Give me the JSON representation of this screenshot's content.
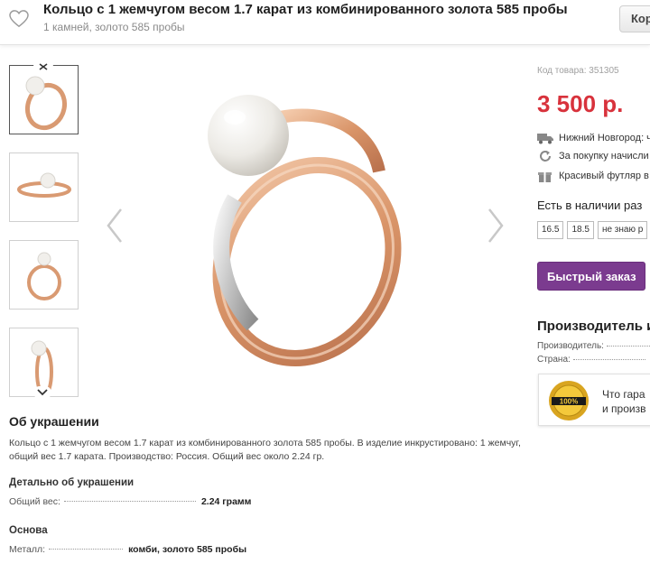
{
  "header": {
    "title": "Кольцо с 1 жемчугом весом 1.7 карат из комбинированного золота 585 пробы",
    "subtitle": "1 камней, золото 585 пробы",
    "top_button_label": "Кор"
  },
  "gallery": {
    "thumbnails": [
      "ring-angle-1",
      "ring-side",
      "ring-front",
      "ring-angle-2"
    ],
    "selected_index": 0
  },
  "product": {
    "sku": "Код товара: 351305",
    "price": "3 500 р.",
    "delivery": "Нижний Новгород: ч",
    "bonus": "За покупку начисли",
    "gift_box": "Красивый футляр в",
    "availability_label": "Есть в наличии раз",
    "sizes": [
      "16.5",
      "18.5",
      "не знаю р"
    ],
    "quick_order_label": "Быстрый заказ"
  },
  "manufacturer": {
    "title": "Производитель и",
    "rows": [
      {
        "key": "Производитель:"
      },
      {
        "key": "Страна:"
      }
    ]
  },
  "guarantee": {
    "seal_text": "100%",
    "line1": "Что гарa",
    "line2": "и произв"
  },
  "about": {
    "title": "Об украшении",
    "text": "Кольцо с 1 жемчугом весом 1.7 карат из комбинированного золота 585 пробы. В изделие инкрустировано: 1 жемчуг, общий вес 1.7 карата. Производство: Россия. Общий вес около 2.24 гр.",
    "details_title": "Детально об украшении",
    "details": [
      {
        "key": "Общий вес:",
        "value": "2.24 грамм"
      }
    ],
    "base_title": "Основа",
    "base": [
      {
        "key": "Металл:",
        "value": "комби, золото 585 пробы"
      }
    ]
  },
  "colors": {
    "price": "#d8323c",
    "button": "#7b3b8f",
    "gold": "#e0a27e",
    "pearl": "#f2f0ec"
  }
}
